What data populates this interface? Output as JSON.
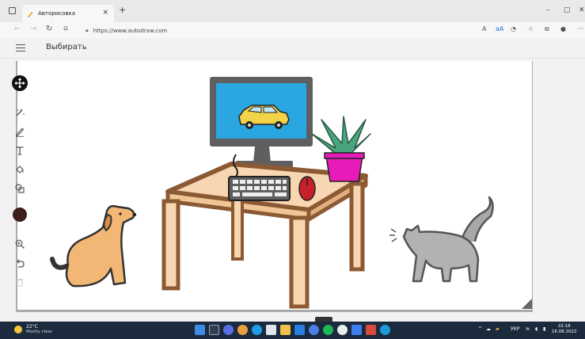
{
  "browser": {
    "tab_title": "Авторисовка",
    "tab_close": "×",
    "new_tab": "+",
    "url": "https://www.autodraw.com",
    "translate_label": "aA",
    "win_minimize": "–",
    "win_restore": "▢",
    "win_close": "✕",
    "more": "···"
  },
  "app": {
    "toolbar_label": "Выбирать"
  },
  "taskbar": {
    "temperature": "22°C",
    "weather": "Mostly clear",
    "language": "УКР",
    "time": "22:18",
    "date": "16.08.2022"
  },
  "colors": {
    "accent": "#111111",
    "current_color": "#3d1f1d",
    "taskbar": "#1b2a3d"
  },
  "icons": {
    "tools": [
      "move-icon",
      "autodraw-icon",
      "pencil-icon",
      "text-icon",
      "fill-icon",
      "shape-icon",
      "zoom-icon",
      "undo-icon",
      "delete-icon"
    ]
  }
}
